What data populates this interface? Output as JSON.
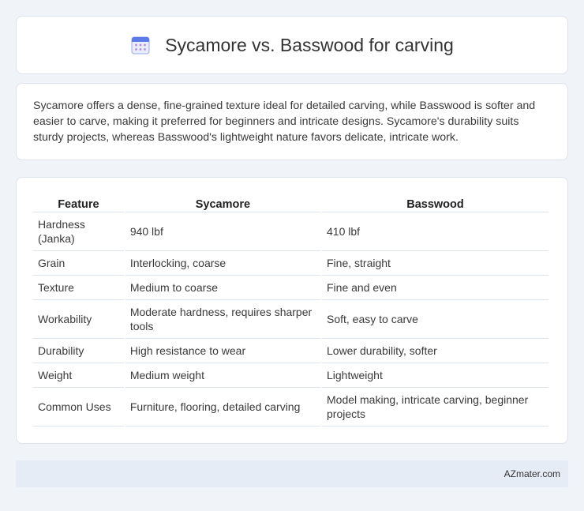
{
  "header": {
    "title": "Sycamore vs. Basswood for carving",
    "icon": "calendar-icon"
  },
  "summary": {
    "text": "Sycamore offers a dense, fine-grained texture ideal for detailed carving, while Basswood is softer and easier to carve, making it preferred for beginners and intricate designs. Sycamore's durability suits sturdy projects, whereas Basswood's lightweight nature favors delicate, intricate work."
  },
  "table": {
    "headers": [
      "Feature",
      "Sycamore",
      "Basswood"
    ],
    "rows": [
      [
        "Hardness (Janka)",
        "940 lbf",
        "410 lbf"
      ],
      [
        "Grain",
        "Interlocking, coarse",
        "Fine, straight"
      ],
      [
        "Texture",
        "Medium to coarse",
        "Fine and even"
      ],
      [
        "Workability",
        "Moderate hardness, requires sharper tools",
        "Soft, easy to carve"
      ],
      [
        "Durability",
        "High resistance to wear",
        "Lower durability, softer"
      ],
      [
        "Weight",
        "Medium weight",
        "Lightweight"
      ],
      [
        "Common Uses",
        "Furniture, flooring, detailed carving",
        "Model making, intricate carving, beginner projects"
      ]
    ]
  },
  "footer": {
    "text": "AZmater.com"
  }
}
